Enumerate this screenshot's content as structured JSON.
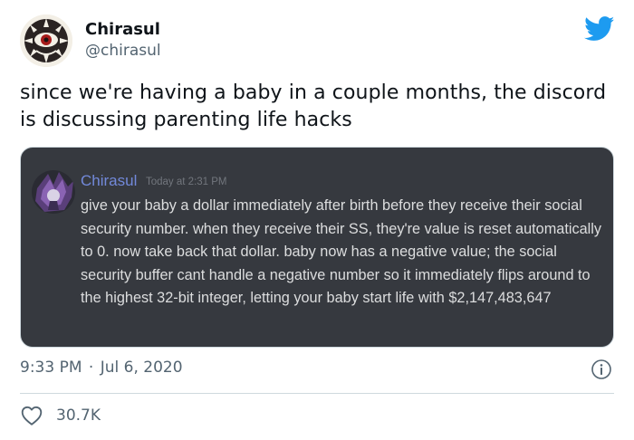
{
  "author": {
    "name": "Chirasul",
    "handle": "@chirasul"
  },
  "tweet": {
    "text": "since we're having a baby in a couple months, the discord is discussing parenting life hacks"
  },
  "embedded_screenshot": {
    "username": "Chirasul",
    "timestamp": "Today at 2:31 PM",
    "message": "give your baby a dollar immediately after birth before they receive their social security number. when they receive their SS, they're value is reset automatically to 0. now take back that dollar. baby now has a negative value; the social security buffer cant handle a negative number so it immediately flips around to the highest 32-bit integer, letting your baby start life with $2,147,483,647",
    "username_color": "#7289da",
    "background_color": "#36393f"
  },
  "meta": {
    "time": "9:33 PM",
    "separator": "·",
    "date": "Jul 6, 2020"
  },
  "actions": {
    "like_count": "30.7K"
  },
  "icons": {
    "brand": "twitter-bird-icon",
    "info": "info-icon",
    "like": "heart-icon"
  },
  "colors": {
    "brand": "#1d9bf0",
    "secondary_text": "#536471"
  }
}
